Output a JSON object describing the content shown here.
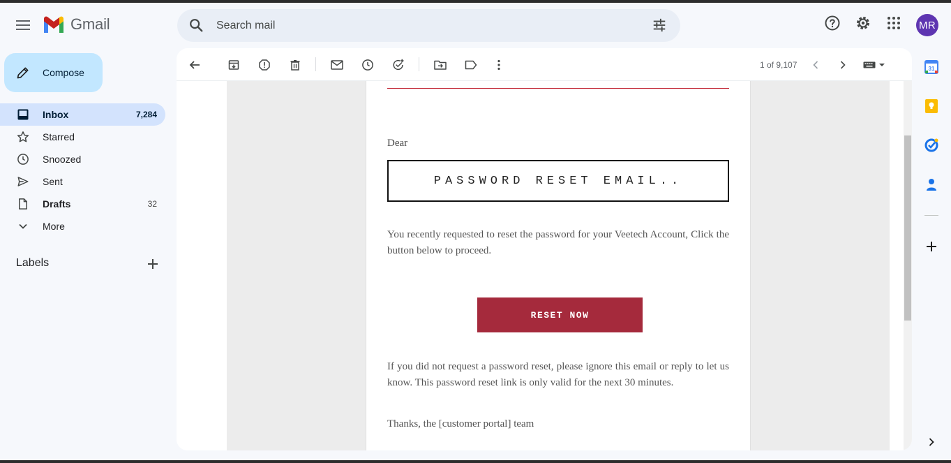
{
  "app": {
    "name": "Gmail"
  },
  "search": {
    "placeholder": "Search mail"
  },
  "user": {
    "avatar_initials": "MR",
    "avatar_color": "#5e35b1"
  },
  "compose": {
    "label": "Compose"
  },
  "nav": [
    {
      "label": "Inbox",
      "count": "7,284",
      "icon": "inbox-icon",
      "active": true
    },
    {
      "label": "Starred",
      "count": "",
      "icon": "star-icon"
    },
    {
      "label": "Snoozed",
      "count": "",
      "icon": "clock-icon"
    },
    {
      "label": "Sent",
      "count": "",
      "icon": "send-icon"
    },
    {
      "label": "Drafts",
      "count": "32",
      "icon": "draft-icon",
      "bold": true
    },
    {
      "label": "More",
      "count": "",
      "icon": "chevron-down-icon"
    }
  ],
  "labels": {
    "heading": "Labels"
  },
  "toolbar": {
    "pager_text": "1 of 9,107",
    "icons": [
      "back-arrow-icon",
      "archive-icon",
      "report-spam-icon",
      "delete-icon",
      "mark-unread-icon",
      "snooze-icon",
      "add-task-icon",
      "move-to-icon",
      "label-icon",
      "more-vert-icon",
      "newer-icon",
      "older-icon",
      "input-tools-icon"
    ]
  },
  "email": {
    "greeting": "Dear",
    "heading": "PASSWORD RESET EMAIL..",
    "body1": "You recently requested to reset the password for your Veetech Account, Click the button below to proceed.",
    "button_label": "RESET NOW",
    "body2": "If you did not request a password reset, please ignore this email or reply to let us know. This password reset link is only valid for the next 30 minutes.",
    "signoff": "Thanks, the [customer portal] team",
    "accent_color": "#a52a3c"
  },
  "side_panel": {
    "calendar_day": "31",
    "icons": [
      "calendar-icon",
      "keep-icon",
      "tasks-icon",
      "contacts-icon",
      "add-addon-icon",
      "expand-panel-icon"
    ]
  }
}
